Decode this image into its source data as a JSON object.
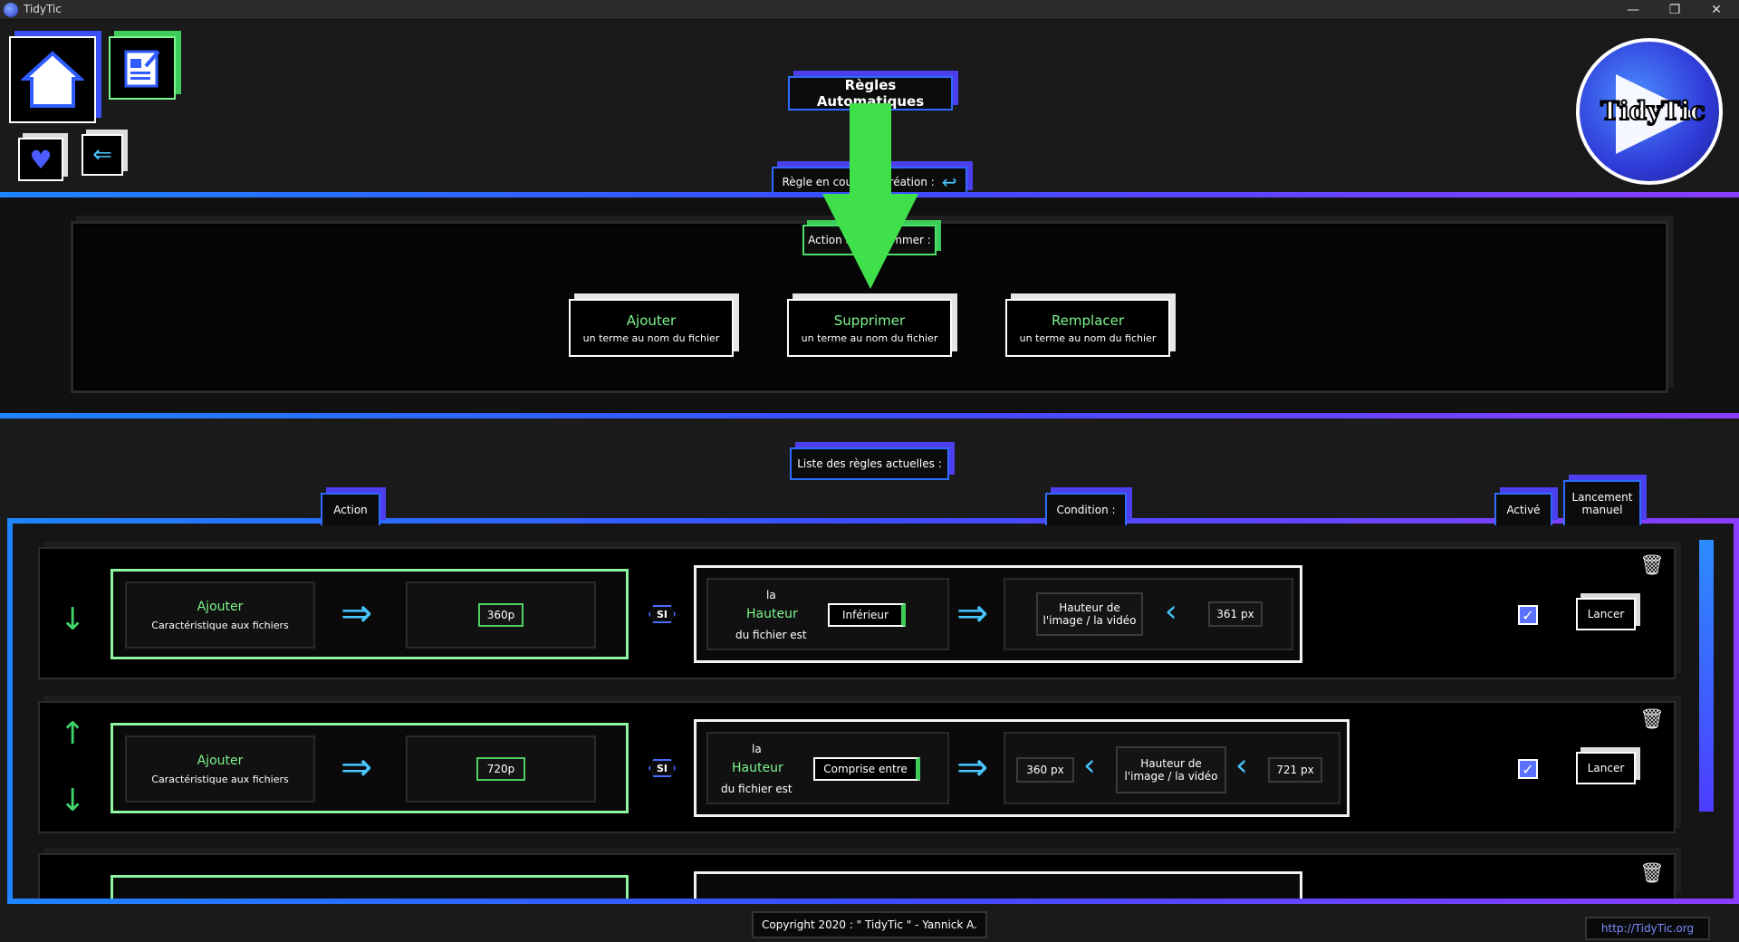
{
  "window": {
    "title": "TidyTic",
    "minimize_glyph": "—",
    "maximize_glyph": "❐",
    "close_glyph": "✕"
  },
  "nav": {
    "home_icon": "home-icon",
    "edit_icon": "edit-document-icon",
    "heart_icon": "heart-icon",
    "back_icon": "back-arrow-icon"
  },
  "logo": {
    "text": "TidyTic"
  },
  "header": {
    "title": "Règles Automatiques",
    "current_rule_label": "Règle en cours de création :",
    "action_to_program_label": "Action à programmer :"
  },
  "actions": [
    {
      "title": "Ajouter",
      "subtitle": "un terme au nom du fichier"
    },
    {
      "title": "Supprimer",
      "subtitle": "un terme au nom du fichier"
    },
    {
      "title": "Remplacer",
      "subtitle": "un terme au nom du fichier"
    }
  ],
  "rules_list": {
    "title": "Liste des règles actuelles :",
    "col_action": "Action",
    "col_condition": "Condition :",
    "col_active": "Activé",
    "col_manual_1": "Lancement",
    "col_manual_2": "manuel"
  },
  "rules": [
    {
      "action_title": "Ajouter",
      "action_subtitle": "Caractéristique aux fichiers",
      "value": "360p",
      "si": "SI",
      "cond_la": "la",
      "cond_prop": "Hauteur",
      "cond_of": "du fichier est",
      "operator": "Inférieur",
      "target_1": "Hauteur de",
      "target_2": "l'image / la vidéo",
      "bound": "361 px",
      "active": true,
      "launch": "Lancer"
    },
    {
      "action_title": "Ajouter",
      "action_subtitle": "Caractéristique aux fichiers",
      "value": "720p",
      "si": "SI",
      "cond_la": "la",
      "cond_prop": "Hauteur",
      "cond_of": "du fichier est",
      "operator": "Comprise entre",
      "low": "360 px",
      "target_1": "Hauteur de",
      "target_2": "l'image / la vidéo",
      "high": "721 px",
      "active": true,
      "launch": "Lancer"
    }
  ],
  "footer": {
    "copyright": "Copyright 2020 : \" TidyTic \" - Yannick A.",
    "url": "http://TidyTic.org"
  },
  "colors": {
    "accent_blue": "#2f6bff",
    "accent_purple": "#8a3dff",
    "accent_green": "#3dcc5a",
    "highlight_arrow": "#3fe04a"
  }
}
